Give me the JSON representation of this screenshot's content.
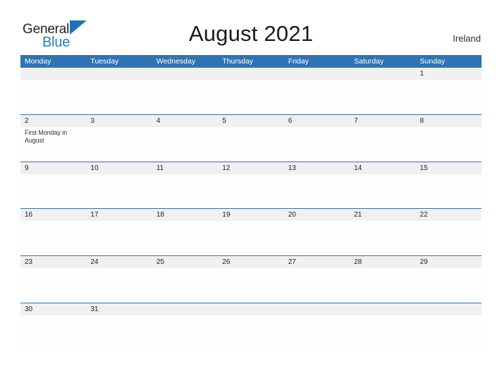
{
  "brand": {
    "name_part1": "General",
    "name_part2": "Blue",
    "triangle_icon": "triangle-icon",
    "accent_color": "#1f7fc8"
  },
  "header": {
    "title": "August 2021",
    "country": "Ireland"
  },
  "colors": {
    "header_blue": "#2e74b5",
    "row_band_gray": "#f0f0f0",
    "row_divider": "#2e74b5",
    "text_dark": "#222222",
    "logo_blue": "#1f7fc8"
  },
  "calendar": {
    "month": "August",
    "year": "2021",
    "weekday_headers": [
      "Monday",
      "Tuesday",
      "Wednesday",
      "Thursday",
      "Friday",
      "Saturday",
      "Sunday"
    ],
    "weeks": [
      {
        "days": [
          {
            "num": "",
            "event": ""
          },
          {
            "num": "",
            "event": ""
          },
          {
            "num": "",
            "event": ""
          },
          {
            "num": "",
            "event": ""
          },
          {
            "num": "",
            "event": ""
          },
          {
            "num": "",
            "event": ""
          },
          {
            "num": "1",
            "event": ""
          }
        ]
      },
      {
        "days": [
          {
            "num": "2",
            "event": "First Monday in August"
          },
          {
            "num": "3",
            "event": ""
          },
          {
            "num": "4",
            "event": ""
          },
          {
            "num": "5",
            "event": ""
          },
          {
            "num": "6",
            "event": ""
          },
          {
            "num": "7",
            "event": ""
          },
          {
            "num": "8",
            "event": ""
          }
        ]
      },
      {
        "days": [
          {
            "num": "9",
            "event": ""
          },
          {
            "num": "10",
            "event": ""
          },
          {
            "num": "11",
            "event": ""
          },
          {
            "num": "12",
            "event": ""
          },
          {
            "num": "13",
            "event": ""
          },
          {
            "num": "14",
            "event": ""
          },
          {
            "num": "15",
            "event": ""
          }
        ]
      },
      {
        "days": [
          {
            "num": "16",
            "event": ""
          },
          {
            "num": "17",
            "event": ""
          },
          {
            "num": "18",
            "event": ""
          },
          {
            "num": "19",
            "event": ""
          },
          {
            "num": "20",
            "event": ""
          },
          {
            "num": "21",
            "event": ""
          },
          {
            "num": "22",
            "event": ""
          }
        ]
      },
      {
        "days": [
          {
            "num": "23",
            "event": ""
          },
          {
            "num": "24",
            "event": ""
          },
          {
            "num": "25",
            "event": ""
          },
          {
            "num": "26",
            "event": ""
          },
          {
            "num": "27",
            "event": ""
          },
          {
            "num": "28",
            "event": ""
          },
          {
            "num": "29",
            "event": ""
          }
        ]
      },
      {
        "days": [
          {
            "num": "30",
            "event": ""
          },
          {
            "num": "31",
            "event": ""
          },
          {
            "num": "",
            "event": ""
          },
          {
            "num": "",
            "event": ""
          },
          {
            "num": "",
            "event": ""
          },
          {
            "num": "",
            "event": ""
          },
          {
            "num": "",
            "event": ""
          }
        ]
      }
    ]
  }
}
